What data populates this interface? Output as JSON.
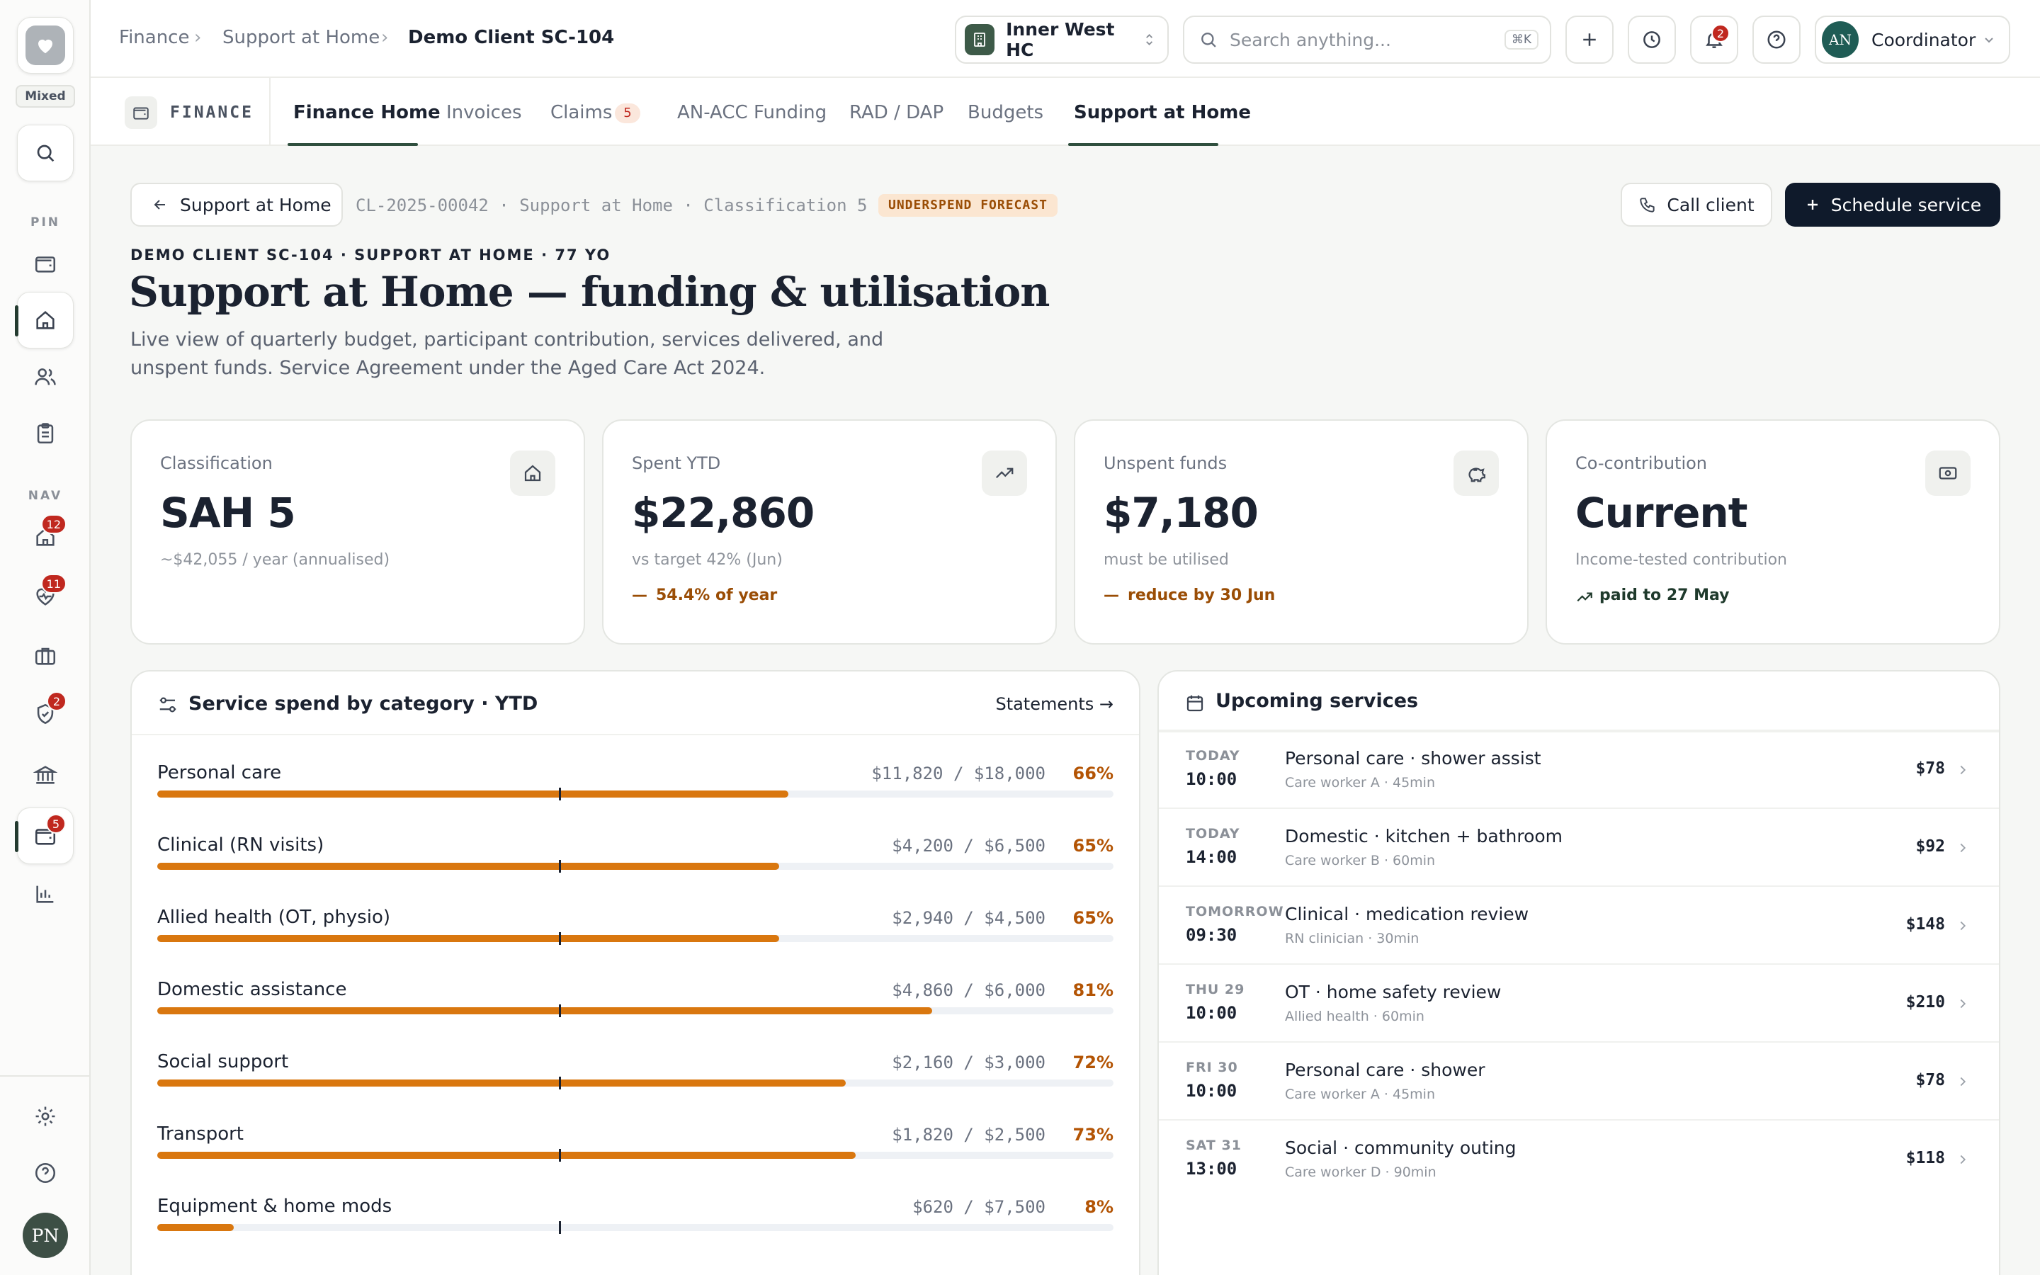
{
  "rail": {
    "mode_badge": "Mixed",
    "pin_label": "PIN",
    "nav_label": "NAV",
    "badges": {
      "home_alerts": "12",
      "clinical_alerts": "11",
      "compliance_alerts": "2",
      "finance_alerts": "5"
    },
    "avatar_initials": "PN"
  },
  "breadcrumb": {
    "items": [
      "Finance",
      "Support at Home"
    ],
    "current": "Demo Client SC-104"
  },
  "facility": {
    "name": "Inner West HC"
  },
  "search": {
    "placeholder": "Search anything...",
    "shortcut": "⌘K"
  },
  "notifications": {
    "count": "2"
  },
  "user": {
    "initials": "AN",
    "role": "Coordinator"
  },
  "module": {
    "label": "FINANCE"
  },
  "tabs": [
    {
      "label": "Finance Home"
    },
    {
      "label": "Invoices"
    },
    {
      "label": "Claims",
      "badge": "5"
    },
    {
      "label": "AN-ACC Funding"
    },
    {
      "label": "RAD / DAP"
    },
    {
      "label": "Budgets"
    },
    {
      "label": "Support at Home"
    }
  ],
  "page": {
    "back_label": "Support at Home",
    "reference": "CL-2025-00042 · Support at Home · Classification 5",
    "status_pill": "UNDERSPEND FORECAST",
    "call_label": "Call client",
    "schedule_label": "Schedule service",
    "eyebrow": "DEMO CLIENT SC-104 · SUPPORT AT HOME · 77 YO",
    "title": "Support at Home — funding & utilisation",
    "description_line1": "Live view of quarterly budget, participant contribution, services delivered, and",
    "description_line2": "unspent funds. Service Agreement under the Aged Care Act 2024."
  },
  "kpis": [
    {
      "label": "Classification",
      "value": "SAH 5",
      "sub": "~$42,055 / year (annualised)",
      "note": ""
    },
    {
      "label": "Spent YTD",
      "value": "$22,860",
      "sub": "vs target 42% (Jun)",
      "note": "54.4% of year"
    },
    {
      "label": "Unspent funds",
      "value": "$7,180",
      "sub": "must be utilised",
      "note": "reduce by 30 Jun"
    },
    {
      "label": "Co-contribution",
      "value": "Current",
      "sub": "Income-tested contribution",
      "note": "paid to 27 May"
    }
  ],
  "spend": {
    "title": "Service spend by category · YTD",
    "link": "Statements →",
    "rows": [
      {
        "name": "Personal care",
        "amount": "$11,820 / $18,000",
        "pct": "66%",
        "value": 0.66
      },
      {
        "name": "Clinical (RN visits)",
        "amount": "$4,200 / $6,500",
        "pct": "65%",
        "value": 0.65
      },
      {
        "name": "Allied health (OT, physio)",
        "amount": "$2,940 / $4,500",
        "pct": "65%",
        "value": 0.65
      },
      {
        "name": "Domestic assistance",
        "amount": "$4,860 / $6,000",
        "pct": "81%",
        "value": 0.81
      },
      {
        "name": "Social support",
        "amount": "$2,160 / $3,000",
        "pct": "72%",
        "value": 0.72
      },
      {
        "name": "Transport",
        "amount": "$1,820 / $2,500",
        "pct": "73%",
        "value": 0.73
      },
      {
        "name": "Equipment & home mods",
        "amount": "$620 / $7,500",
        "pct": "8%",
        "value": 0.08
      }
    ],
    "target_marker": 0.42
  },
  "upcoming": {
    "title": "Upcoming services",
    "items": [
      {
        "day": "TODAY",
        "time": "10:00",
        "title": "Personal care · shower assist",
        "meta": "Care worker A · 45min",
        "price": "$78"
      },
      {
        "day": "TODAY",
        "time": "14:00",
        "title": "Domestic · kitchen + bathroom",
        "meta": "Care worker B · 60min",
        "price": "$92"
      },
      {
        "day": "TOMORROW",
        "time": "09:30",
        "title": "Clinical · medication review",
        "meta": "RN clinician · 30min",
        "price": "$148"
      },
      {
        "day": "THU 29",
        "time": "10:00",
        "title": "OT · home safety review",
        "meta": "Allied health · 60min",
        "price": "$210"
      },
      {
        "day": "FRI 30",
        "time": "10:00",
        "title": "Personal care · shower",
        "meta": "Care worker A · 45min",
        "price": "$78"
      },
      {
        "day": "SAT 31",
        "time": "13:00",
        "title": "Social · community outing",
        "meta": "Care worker D · 90min",
        "price": "$118"
      }
    ]
  },
  "colors": {
    "accent": "#0f1a2b",
    "bar": "#d9770f",
    "warn": "#b35404",
    "brand": "#2f4f3e"
  }
}
